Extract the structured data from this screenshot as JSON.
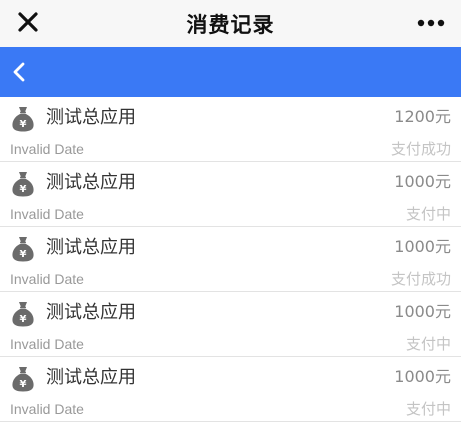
{
  "window": {
    "title": "消费记录",
    "close_icon": "close-icon",
    "more_icon": "more-dots-icon"
  },
  "navbar": {
    "back_icon": "chevron-left-icon",
    "color": "#3a79f5"
  },
  "records": [
    {
      "app": "测试总应用",
      "amount": "1200元",
      "date": "Invalid Date",
      "status": "支付成功",
      "icon": "money-bag-icon"
    },
    {
      "app": "测试总应用",
      "amount": "1000元",
      "date": "Invalid Date",
      "status": "支付中",
      "icon": "money-bag-icon"
    },
    {
      "app": "测试总应用",
      "amount": "1000元",
      "date": "Invalid Date",
      "status": "支付成功",
      "icon": "money-bag-icon"
    },
    {
      "app": "测试总应用",
      "amount": "1000元",
      "date": "Invalid Date",
      "status": "支付中",
      "icon": "money-bag-icon"
    },
    {
      "app": "测试总应用",
      "amount": "1000元",
      "date": "Invalid Date",
      "status": "支付中",
      "icon": "money-bag-icon"
    }
  ]
}
